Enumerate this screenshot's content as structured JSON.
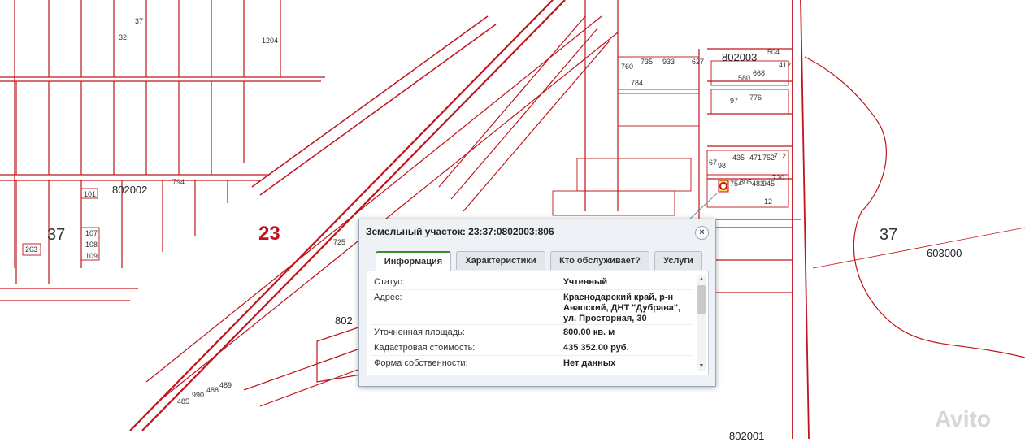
{
  "map": {
    "quarter_labels": [
      {
        "text": "802002"
      },
      {
        "text": "802003"
      },
      {
        "text": "802001"
      },
      {
        "text": "802"
      },
      {
        "text": "603000"
      }
    ],
    "region_labels": [
      {
        "text": "37"
      },
      {
        "text": "37"
      },
      {
        "text": "23"
      }
    ],
    "plot_labels": [
      "1204",
      "32",
      "37",
      "101",
      "107",
      "108",
      "109",
      "263",
      "794",
      "725",
      "12",
      "760",
      "735",
      "933",
      "627",
      "580",
      "668",
      "504",
      "412",
      "784",
      "776",
      "97",
      "67",
      "435",
      "98",
      "471",
      "752",
      "712",
      "720",
      "805",
      "483",
      "945",
      "754",
      "485",
      "990",
      "488",
      "489"
    ]
  },
  "popup": {
    "title": "Земельный участок: 23:37:0802003:806",
    "close_symbol": "×",
    "tabs": [
      "Информация",
      "Характеристики",
      "Кто обслуживает?",
      "Услуги"
    ],
    "rows": [
      {
        "label": "Статус:",
        "value": "Учтенный"
      },
      {
        "label": "Адрес:",
        "value": "Краснодарский край, р-н\nАнапский, ДНТ \"Дубрава\",\nул. Просторная, 30"
      },
      {
        "label": "Уточненная площадь:",
        "value": "800.00 кв. м"
      },
      {
        "label": "Кадастровая стоимость:",
        "value": "435 352.00 руб."
      },
      {
        "label": "Форма собственности:",
        "value": "Нет данных"
      }
    ]
  },
  "watermark": "Avito",
  "colors": {
    "boundary": "#c0141c",
    "popup_border": "#9aa7b6",
    "active_tab": "#3a8e2e"
  }
}
